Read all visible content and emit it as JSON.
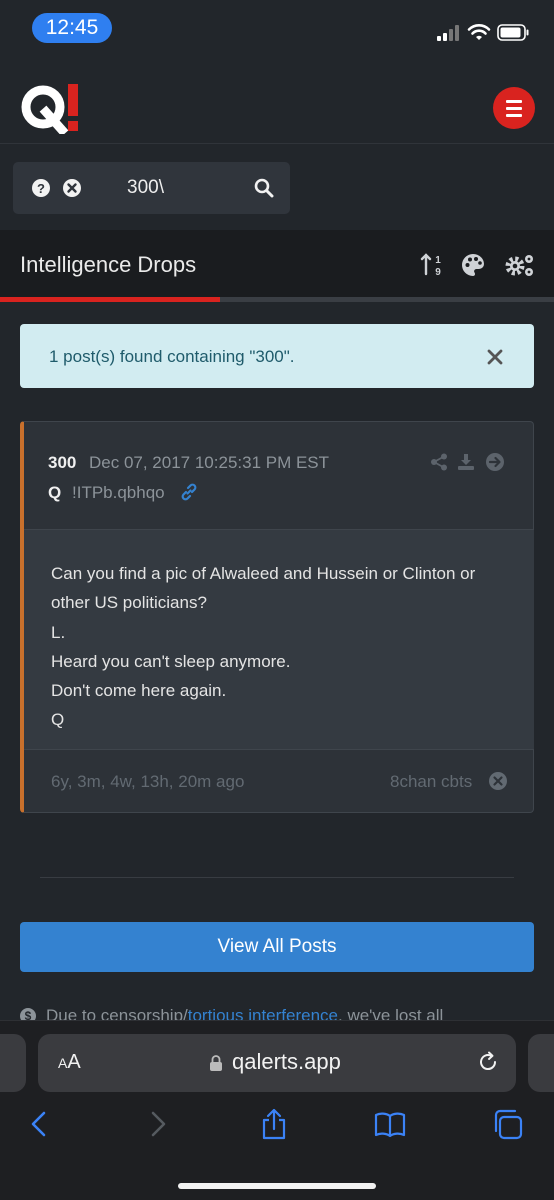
{
  "status": {
    "time": "12:45"
  },
  "header": {
    "logo_alt": "Q!"
  },
  "search": {
    "query": "300\\"
  },
  "page": {
    "title": "Intelligence Drops"
  },
  "alert": {
    "message": "1 post(s) found containing \"300\"."
  },
  "post": {
    "number": "300",
    "date": "Dec 07, 2017 10:25:31 PM EST",
    "author": "Q",
    "tripcode": "!ITPb.qbhqo",
    "body_lines": [
      "Can you find a pic of Alwaleed and Hussein or Clinton or",
      "other US politicians?",
      "L.",
      "Heard you can't sleep anymore.",
      "Don't come here again.",
      "Q"
    ],
    "age": "6y, 3m, 4w, 13h, 20m ago",
    "source": "8chan cbts"
  },
  "view_all_label": "View All Posts",
  "notice": {
    "prefix": "Due to censorship/",
    "link": "tortious interference",
    "suffix": ", we've lost all"
  },
  "browser": {
    "aa_label": "AA",
    "url": "qalerts.app"
  },
  "colors": {
    "brand_red": "#d9231f",
    "accent_blue": "#3482d0",
    "post_border": "#c8702c",
    "alert_bg": "#d2ecf1"
  }
}
